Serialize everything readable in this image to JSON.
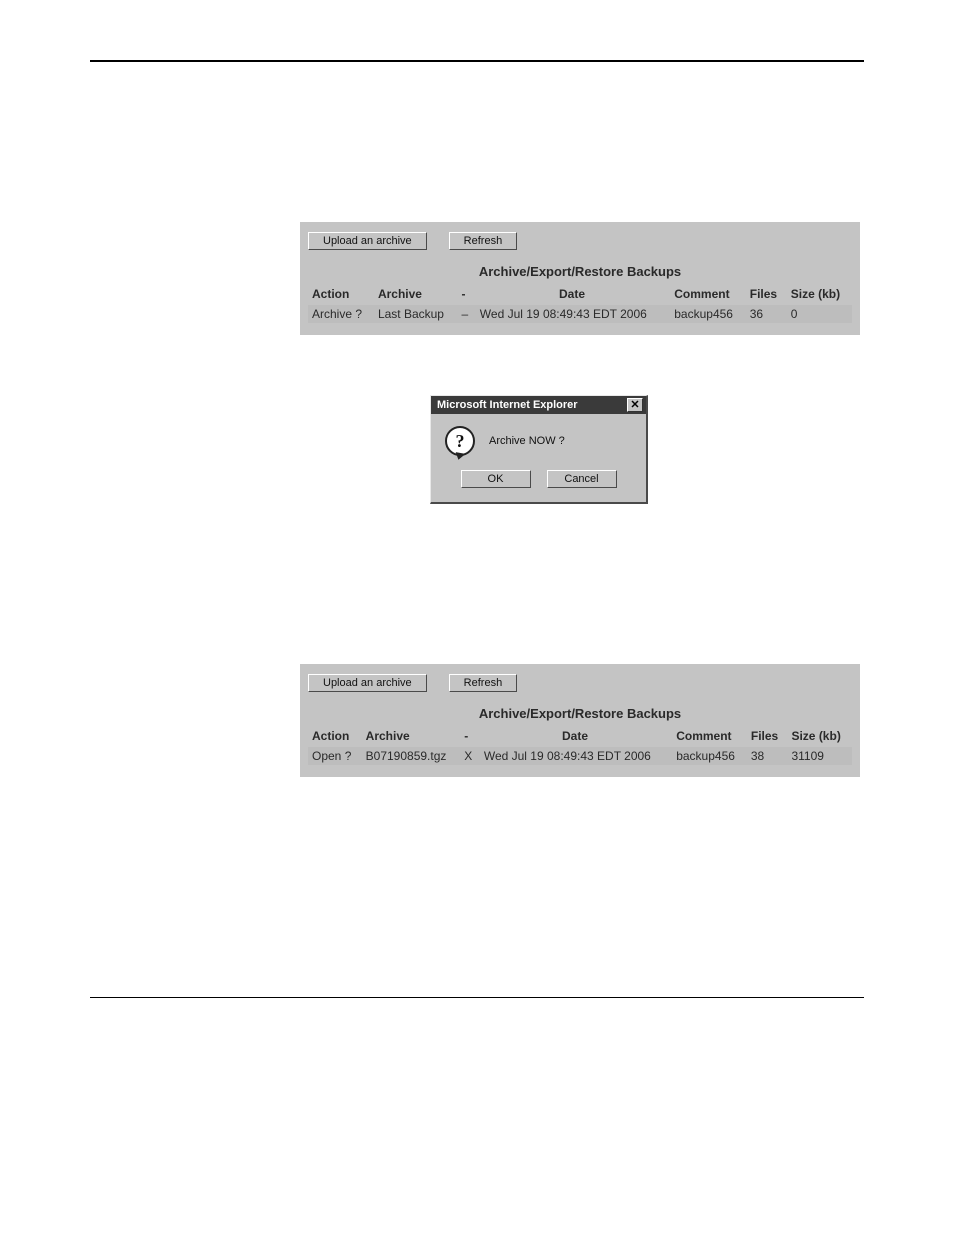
{
  "panel1": {
    "buttons": {
      "upload": "Upload an archive",
      "refresh": "Refresh"
    },
    "title": "Archive/Export/Restore Backups",
    "headers": {
      "action": "Action",
      "archive": "Archive",
      "dash": "-",
      "date": "Date",
      "comment": "Comment",
      "files": "Files",
      "size": "Size (kb)"
    },
    "row": {
      "action": "Archive ?",
      "archive": "Last Backup",
      "dash": "–",
      "date": "Wed Jul 19 08:49:43 EDT 2006",
      "comment": "backup456",
      "files": "36",
      "size": "0"
    }
  },
  "dialog": {
    "title": "Microsoft Internet Explorer",
    "close_glyph": "✕",
    "q_glyph": "?",
    "message": "Archive NOW ?",
    "ok": "OK",
    "cancel": "Cancel"
  },
  "panel2": {
    "buttons": {
      "upload": "Upload an archive",
      "refresh": "Refresh"
    },
    "title": "Archive/Export/Restore Backups",
    "headers": {
      "action": "Action",
      "archive": "Archive",
      "dash": "-",
      "date": "Date",
      "comment": "Comment",
      "files": "Files",
      "size": "Size (kb)"
    },
    "row": {
      "action": "Open ?",
      "archive": "B07190859.tgz",
      "dash": "X",
      "date": "Wed Jul 19 08:49:43 EDT 2006",
      "comment": "backup456",
      "files": "38",
      "size": "31109"
    }
  }
}
